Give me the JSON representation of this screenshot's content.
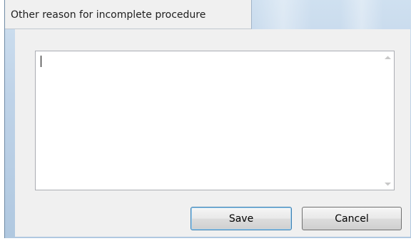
{
  "window": {
    "title": "Other reason for incomplete procedure"
  },
  "reason_input": {
    "value": ""
  },
  "buttons": {
    "save_label": "Save",
    "cancel_label": "Cancel"
  },
  "icons": {
    "scroll_up": "scroll-up-arrow-icon",
    "scroll_down": "scroll-down-arrow-icon"
  },
  "colors": {
    "frame": "#bfd3e8",
    "client_bg": "#f0f0f0",
    "default_button_border": "#3c7fb1"
  }
}
